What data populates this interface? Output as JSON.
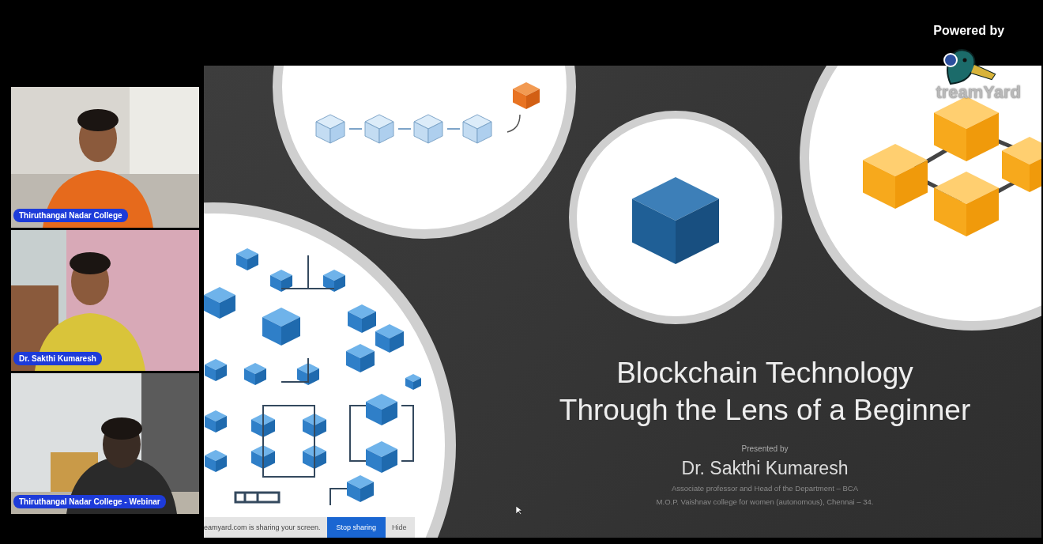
{
  "participants": [
    {
      "name": "Thiruthangal Nadar College"
    },
    {
      "name": "Dr. Sakthi Kumaresh"
    },
    {
      "name": "Thiruthangal Nadar College - Webinar"
    }
  ],
  "branding": {
    "caption": "Powered by",
    "wordmark": "treamYard"
  },
  "slide": {
    "title_lines": [
      "Blockchain Technology",
      "Through the Lens of a Beginner"
    ],
    "presented_label": "Presented by",
    "presenter": "Dr. Sakthi Kumaresh",
    "details": [
      "Associate professor and Head of the Department – BCA",
      "M.O.P. Vaishnav college for women (autonomous), Chennai – 34."
    ]
  },
  "share_bar": {
    "message": "eamyard.com is sharing your screen.",
    "stop_button": "Stop sharing",
    "hide_link": "Hide"
  }
}
